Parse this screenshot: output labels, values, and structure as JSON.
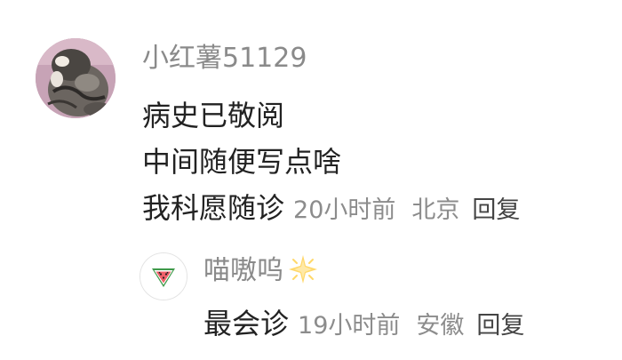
{
  "comment": {
    "username": "小红薯51129",
    "avatar_icon": "cat-photo-avatar",
    "body_lines": [
      "病史已敬阅",
      "中间随便写点啥",
      "我科愿随诊"
    ],
    "time": "20小时前",
    "location": "北京",
    "reply_label": "回复"
  },
  "reply": {
    "username": "喵嗷呜",
    "avatar_icon": "watermelon-icon",
    "badge_icon": "sparkle-star-icon",
    "body": "最会诊",
    "time": "19小时前",
    "location": "安徽",
    "reply_label": "回复"
  },
  "colors": {
    "username": "#8a8a8a",
    "body_text": "#222222",
    "meta_text": "#8c8c8c",
    "reply_text": "#444444",
    "background": "#ffffff"
  }
}
